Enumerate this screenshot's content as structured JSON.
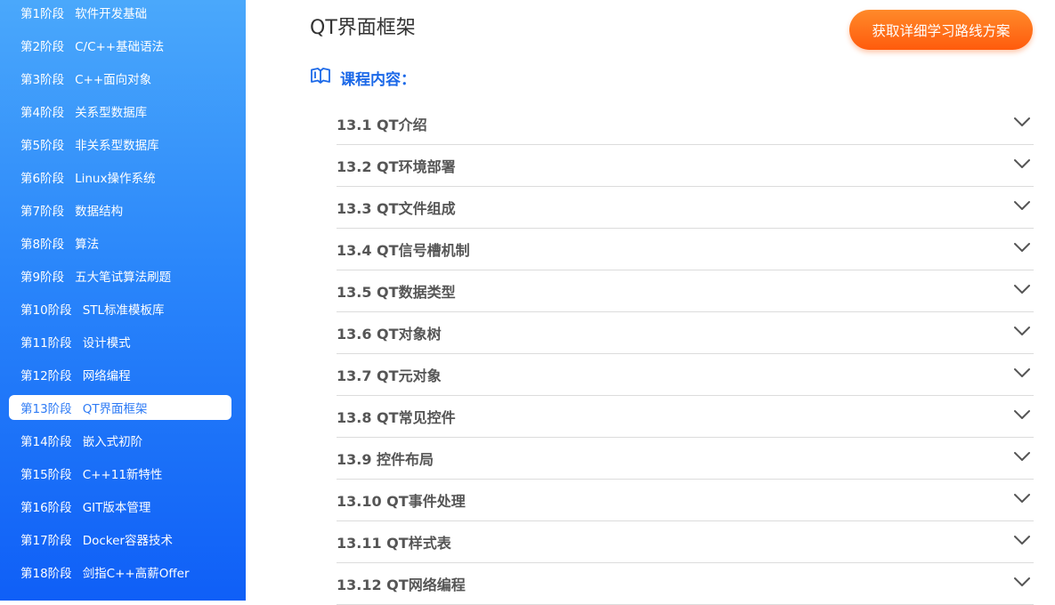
{
  "sidebar": {
    "stages": [
      {
        "no": "第1阶段",
        "name": "软件开发基础"
      },
      {
        "no": "第2阶段",
        "name": "C/C++基础语法"
      },
      {
        "no": "第3阶段",
        "name": "C++面向对象"
      },
      {
        "no": "第4阶段",
        "name": "关系型数据库"
      },
      {
        "no": "第5阶段",
        "name": "非关系型数据库"
      },
      {
        "no": "第6阶段",
        "name": "Linux操作系统"
      },
      {
        "no": "第7阶段",
        "name": "数据结构"
      },
      {
        "no": "第8阶段",
        "name": "算法"
      },
      {
        "no": "第9阶段",
        "name": "五大笔试算法刷题"
      },
      {
        "no": "第10阶段",
        "name": "STL标准模板库"
      },
      {
        "no": "第11阶段",
        "name": "设计模式"
      },
      {
        "no": "第12阶段",
        "name": "网络编程"
      },
      {
        "no": "第13阶段",
        "name": "QT界面框架"
      },
      {
        "no": "第14阶段",
        "name": "嵌入式初阶"
      },
      {
        "no": "第15阶段",
        "name": "C++11新特性"
      },
      {
        "no": "第16阶段",
        "name": "GIT版本管理"
      },
      {
        "no": "第17阶段",
        "name": "Docker容器技术"
      },
      {
        "no": "第18阶段",
        "name": "剑指C++高薪Offer"
      }
    ],
    "active_index": 12
  },
  "main": {
    "title": "QT界面框架",
    "cta_label": "获取详细学习路线方案",
    "section_label": "课程内容：",
    "section_icon": "book-icon",
    "items": [
      {
        "label": "13.1 QT介绍"
      },
      {
        "label": "13.2 QT环境部署"
      },
      {
        "label": "13.3 QT文件组成"
      },
      {
        "label": "13.4 QT信号槽机制"
      },
      {
        "label": "13.5 QT数据类型"
      },
      {
        "label": "13.6 QT对象树"
      },
      {
        "label": "13.7 QT元对象"
      },
      {
        "label": "13.8 QT常见控件"
      },
      {
        "label": "13.9 控件布局"
      },
      {
        "label": "13.10 QT事件处理"
      },
      {
        "label": "13.11 QT样式表"
      },
      {
        "label": "13.12 QT网络编程"
      }
    ],
    "item_icon": "chevron-down-icon"
  },
  "colors": {
    "accent_blue": "#1c69e8",
    "cta_orange": "#ff6a1a",
    "active_text": "#2e7bf5"
  }
}
